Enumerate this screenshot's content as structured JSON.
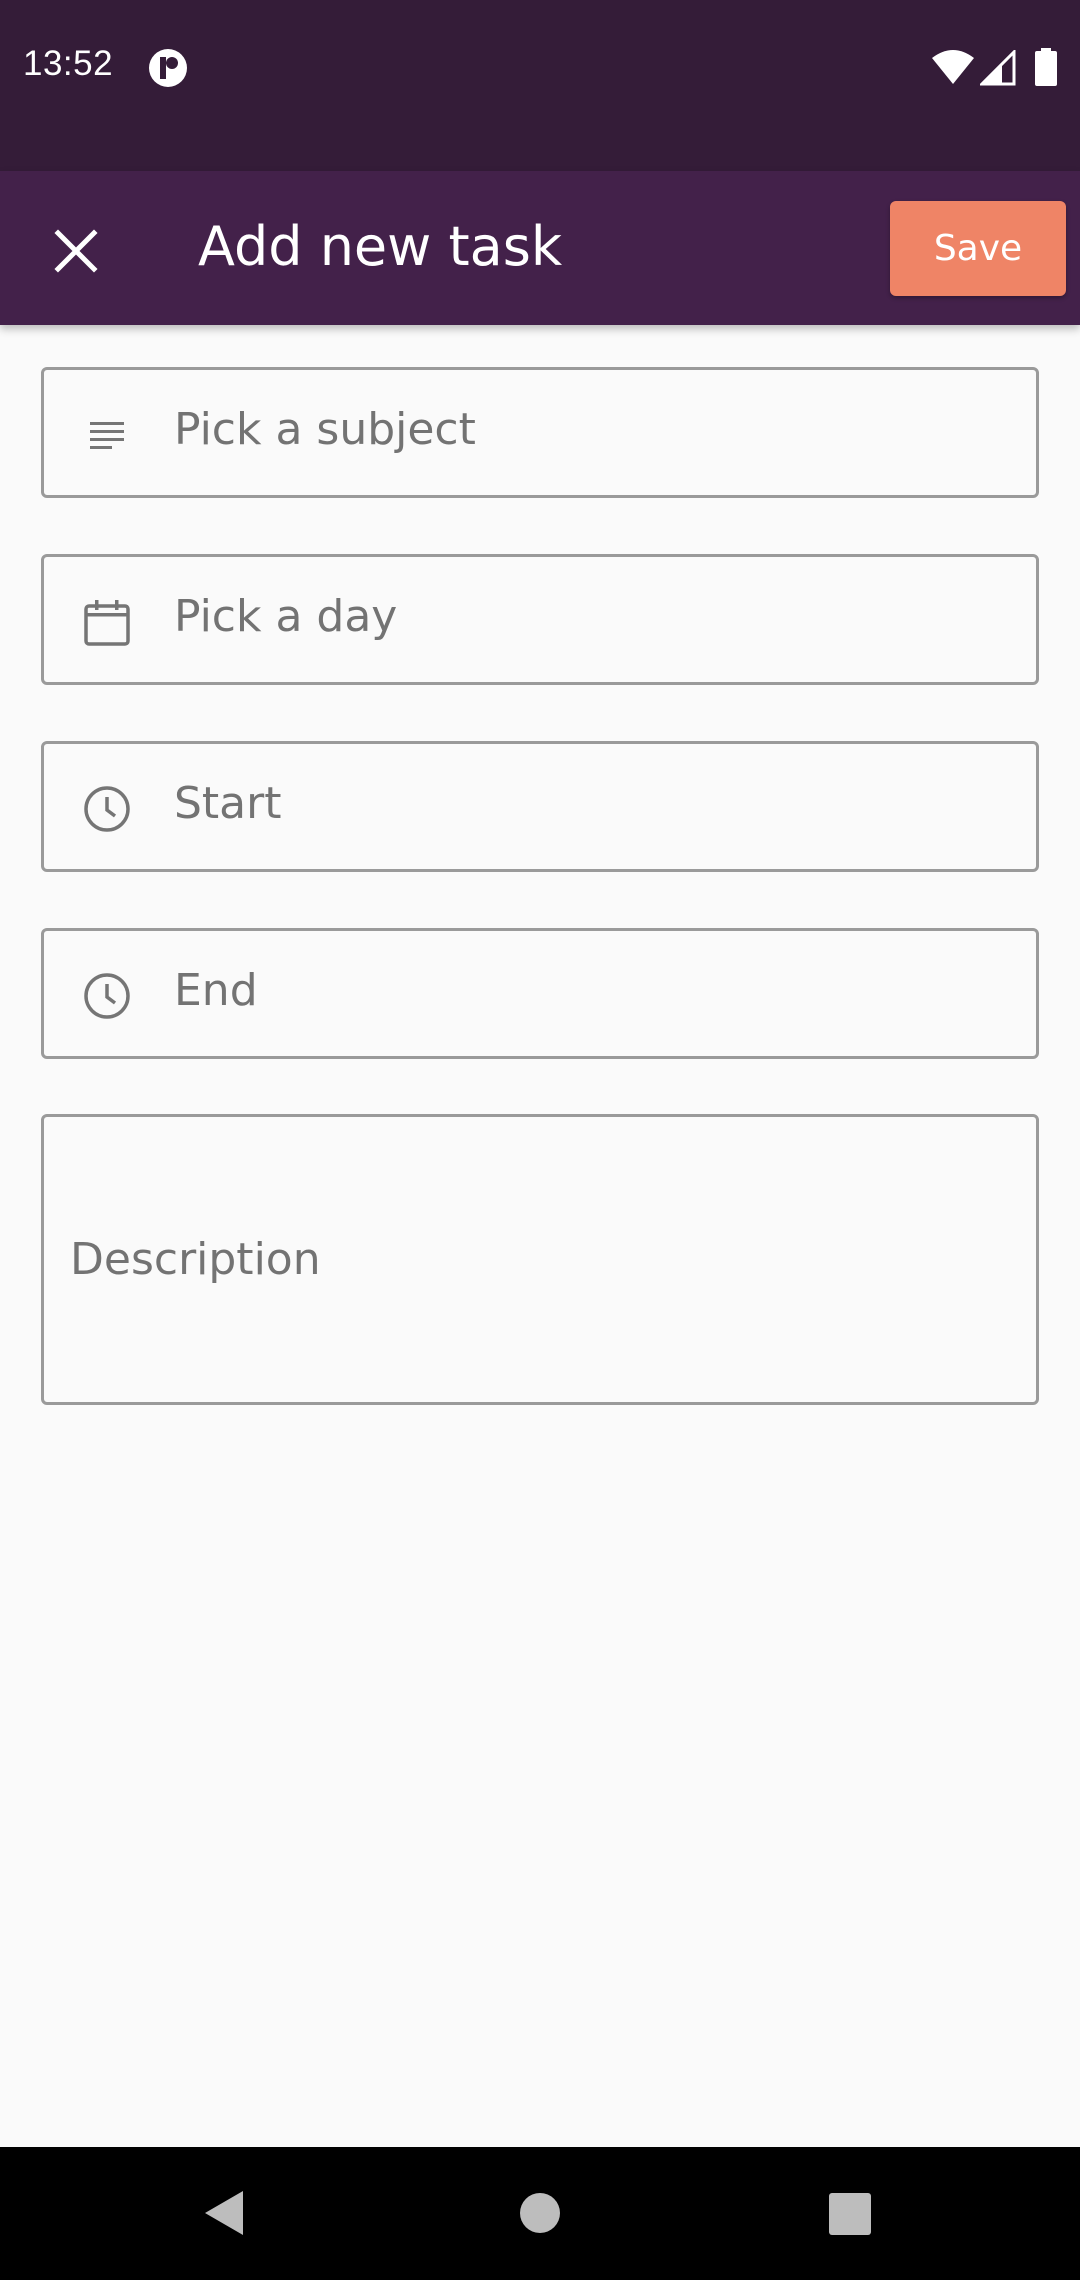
{
  "status_bar": {
    "time": "13:52"
  },
  "app_bar": {
    "title": "Add new task",
    "close_icon": "close-icon",
    "save_label": "Save"
  },
  "form": {
    "subject": {
      "placeholder": "Pick a subject",
      "icon": "subject-lines-icon"
    },
    "day": {
      "placeholder": "Pick a day",
      "icon": "calendar-icon"
    },
    "start": {
      "placeholder": "Start",
      "icon": "clock-icon"
    },
    "end": {
      "placeholder": "End",
      "icon": "clock-icon"
    },
    "description": {
      "placeholder": "Description"
    }
  },
  "colors": {
    "status_bar": "#341c38",
    "app_bar": "#43214a",
    "accent": "#ef8466",
    "background": "#fafafa"
  }
}
